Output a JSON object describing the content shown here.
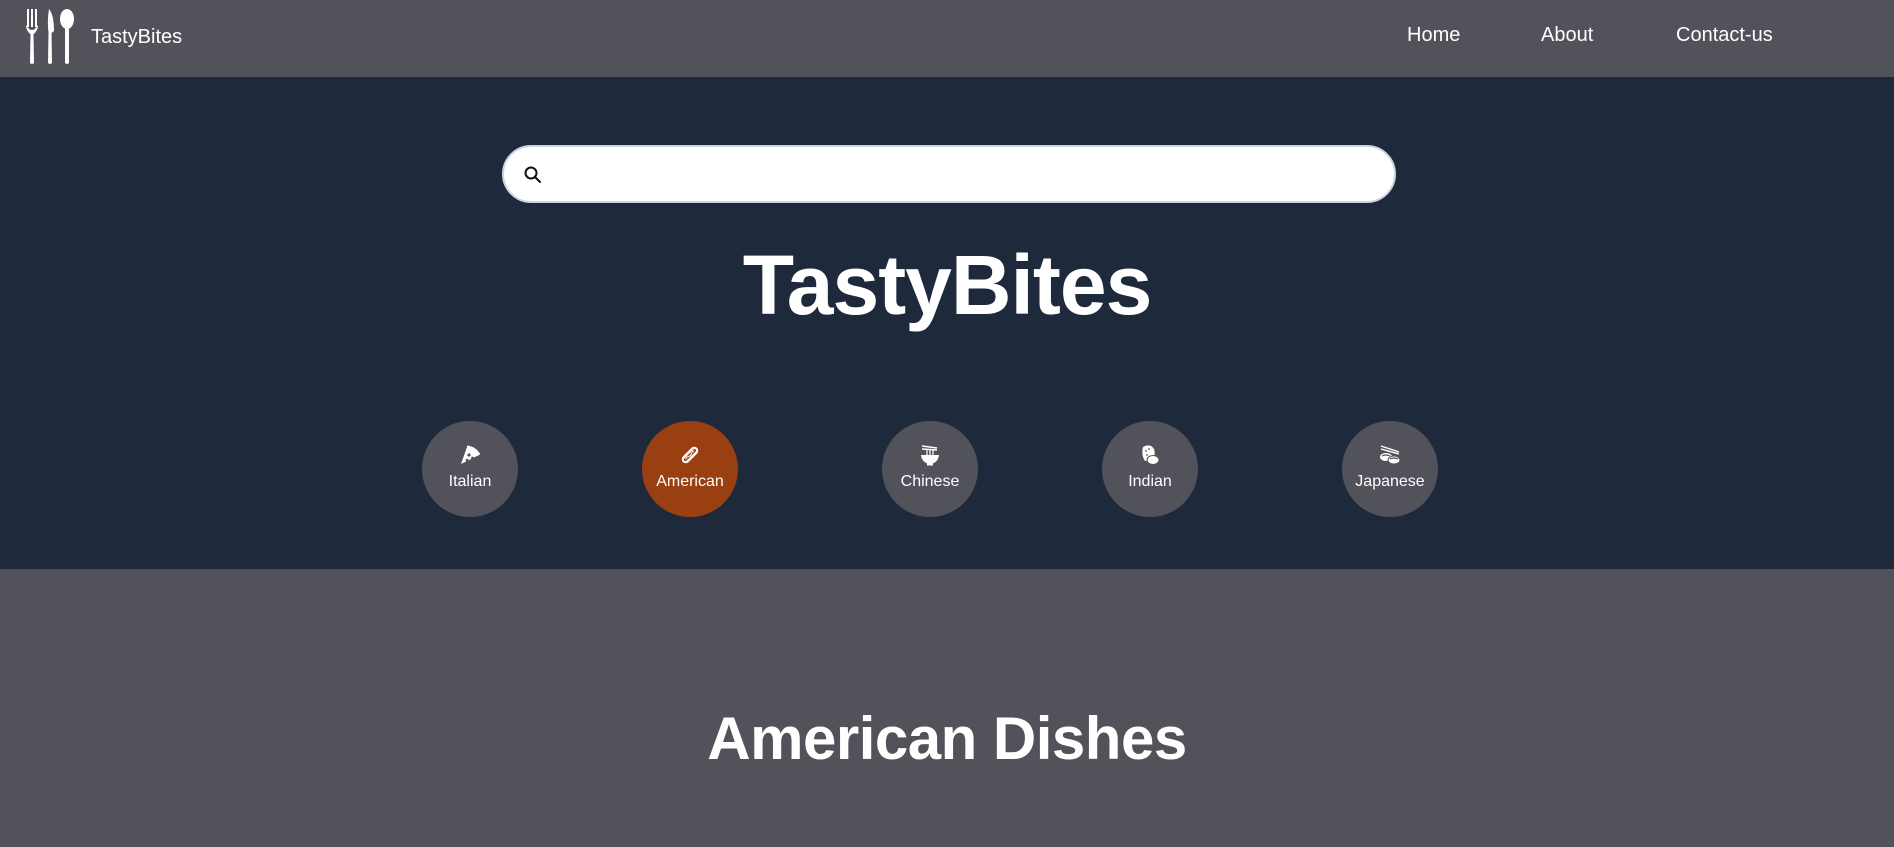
{
  "navbar": {
    "brand": "TastyBites",
    "links": [
      "Home",
      "About",
      "Contact-us"
    ]
  },
  "search": {
    "placeholder": "",
    "value": ""
  },
  "hero": {
    "title": "TastyBites"
  },
  "categories": [
    {
      "label": "Italian",
      "icon": "pizza-icon",
      "active": false
    },
    {
      "label": "American",
      "icon": "hotdog-icon",
      "active": true
    },
    {
      "label": "Chinese",
      "icon": "noodle-bowl-icon",
      "active": false
    },
    {
      "label": "Indian",
      "icon": "naan-icon",
      "active": false
    },
    {
      "label": "Japanese",
      "icon": "sushi-icon",
      "active": false
    }
  ],
  "section": {
    "title": "American Dishes"
  },
  "colors": {
    "navbar": "#52525b",
    "hero": "#1e293b",
    "active_category": "#9a3f12",
    "category": "#52525b"
  }
}
